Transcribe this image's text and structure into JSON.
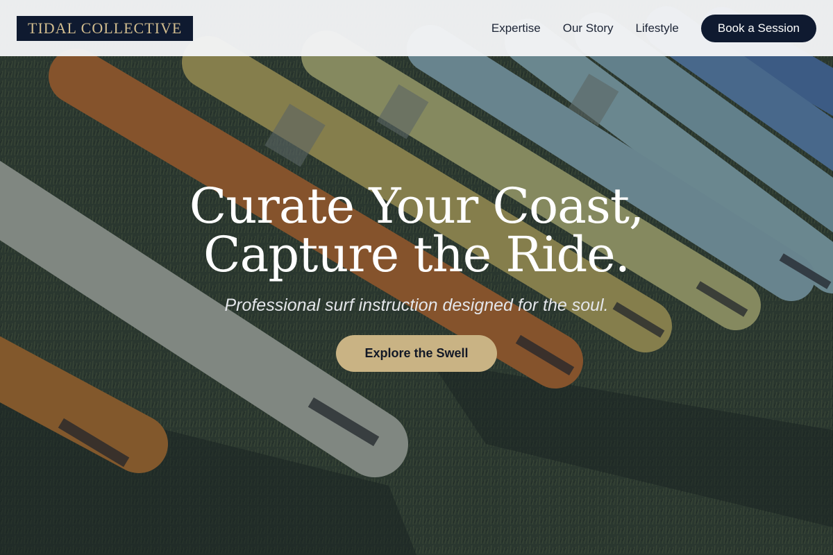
{
  "brand": {
    "name": "TIDAL COLLECTIVE"
  },
  "nav": {
    "links": [
      {
        "label": "Expertise"
      },
      {
        "label": "Our Story"
      },
      {
        "label": "Lifestyle"
      }
    ],
    "cta_label": "Book a Session"
  },
  "hero": {
    "headline_line1": "Curate Your Coast,",
    "headline_line2": "Capture the Ride.",
    "subtitle": "Professional surf instruction designed for the soul.",
    "button_label": "Explore the Swell",
    "background_image": "surfboards lying on grass"
  },
  "colors": {
    "navy": "#0f1a30",
    "gold": "#c9b384",
    "logo_text": "#d2bd8f",
    "nav_bg": "#f4f5f7"
  }
}
